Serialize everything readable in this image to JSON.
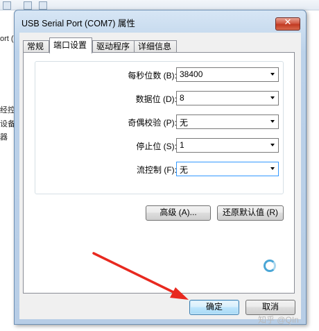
{
  "background": {
    "fragments": [
      "ort (",
      "经控制",
      "设备",
      "器"
    ]
  },
  "dialog": {
    "title": "USB Serial Port (COM7) 属性",
    "close_symbol": "✕",
    "tabs": [
      {
        "label": "常规"
      },
      {
        "label": "端口设置"
      },
      {
        "label": "驱动程序"
      },
      {
        "label": "详细信息"
      }
    ],
    "settings": [
      {
        "label": "每秒位数 (B):",
        "value": "38400"
      },
      {
        "label": "数据位 (D):",
        "value": "8"
      },
      {
        "label": "奇偶校验 (P):",
        "value": "无"
      },
      {
        "label": "停止位 (S):",
        "value": "1"
      },
      {
        "label": "流控制 (F):",
        "value": "无"
      }
    ],
    "advanced_button": "高级 (A)...",
    "restore_button": "还原默认值 (R)",
    "ok_button": "确定",
    "cancel_button": "取消"
  },
  "annotation": {
    "color": "#e8291f"
  },
  "watermark": "知乎 @QIn"
}
